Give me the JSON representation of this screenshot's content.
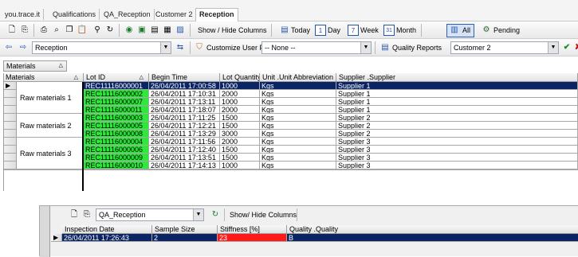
{
  "breadcrumbs": [
    "you.trace.it",
    "Qualifications",
    "QA_Reception",
    "Customer 2",
    "Reception"
  ],
  "toolbar1": {
    "show_hide_columns": "Show / Hide Columns",
    "today": "Today",
    "day": "Day",
    "week": "Week",
    "month": "Month",
    "all": "All",
    "pending": "Pending",
    "day_icon_number": "1",
    "week_icon_number": "7",
    "month_icon_number": "31"
  },
  "toolbar2": {
    "view_select": "Reception",
    "customize_filter_label": "Customize User Filter",
    "filter_select": "-- None --",
    "quality_reports": "Quality Reports",
    "customer_select": "Customer 2"
  },
  "group_panel": {
    "label": "Materials"
  },
  "grid": {
    "columns": [
      "Materials",
      "Lot ID",
      "Begin Time",
      "Lot Quantity",
      "Unit .Unit Abbreviation",
      "Supplier .Supplier"
    ],
    "groups": [
      {
        "name": "Raw materials 1",
        "rows": [
          {
            "lot": "REC11116000001",
            "time": "26/04/2011 17:00:58",
            "qty": "1000",
            "unit": "Kgs",
            "supplier": "Supplier 1"
          },
          {
            "lot": "REC11116000002",
            "time": "26/04/2011 17:10:31",
            "qty": "2000",
            "unit": "Kgs",
            "supplier": "Supplier 1"
          },
          {
            "lot": "REC11116000007",
            "time": "26/04/2011 17:13:11",
            "qty": "1000",
            "unit": "Kgs",
            "supplier": "Supplier 1"
          },
          {
            "lot": "REC11116000011",
            "time": "26/04/2011 17:18:07",
            "qty": "2000",
            "unit": "Kgs",
            "supplier": "Supplier 1"
          }
        ]
      },
      {
        "name": "Raw materials 2",
        "rows": [
          {
            "lot": "REC11116000003",
            "time": "26/04/2011 17:11:25",
            "qty": "1500",
            "unit": "Kgs",
            "supplier": "Supplier 2"
          },
          {
            "lot": "REC11116000005",
            "time": "26/04/2011 17:12:21",
            "qty": "1500",
            "unit": "Kgs",
            "supplier": "Supplier 2"
          },
          {
            "lot": "REC11116000008",
            "time": "26/04/2011 17:13:29",
            "qty": "3000",
            "unit": "Kgs",
            "supplier": "Supplier 2"
          }
        ]
      },
      {
        "name": "Raw materials 3",
        "rows": [
          {
            "lot": "REC11116000004",
            "time": "26/04/2011 17:11:56",
            "qty": "2000",
            "unit": "Kgs",
            "supplier": "Supplier 3"
          },
          {
            "lot": "REC11116000006",
            "time": "26/04/2011 17:12:40",
            "qty": "1500",
            "unit": "Kgs",
            "supplier": "Supplier 3"
          },
          {
            "lot": "REC11116000009",
            "time": "26/04/2011 17:13:51",
            "qty": "1500",
            "unit": "Kgs",
            "supplier": "Supplier 3"
          },
          {
            "lot": "REC11116000010",
            "time": "26/04/2011 17:14:13",
            "qty": "1000",
            "unit": "Kgs",
            "supplier": "Supplier 3"
          }
        ]
      }
    ]
  },
  "qa_panel": {
    "view_select": "QA_Reception",
    "show_hide_columns": "Show/ Hide Columns",
    "columns": [
      "Inspection Date",
      "Sample Size",
      "Stiffness [%]",
      "Quality .Quality"
    ],
    "rows": [
      {
        "date": "26/04/2011 17:26:43",
        "sample": "2",
        "stiffness": "23",
        "quality": "B"
      }
    ]
  },
  "colors": {
    "selected_row": "#0b2463",
    "lot_id_cell": "#2ee83b",
    "stiffness_alert": "#ff1a1a"
  }
}
